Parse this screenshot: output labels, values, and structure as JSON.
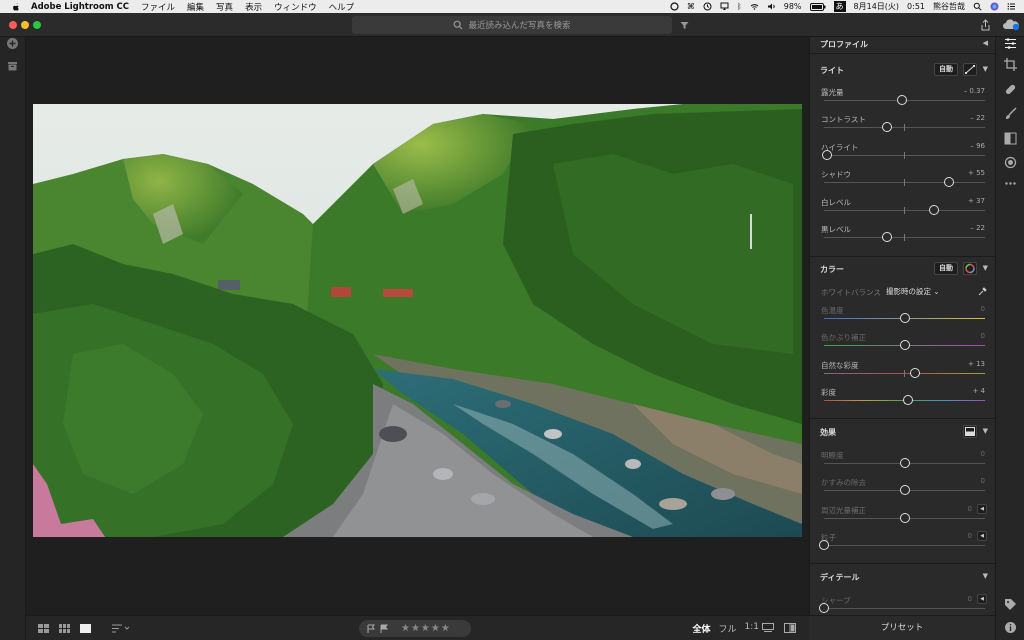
{
  "menubar": {
    "app_name": "Adobe Lightroom CC",
    "menus": [
      "ファイル",
      "編集",
      "写真",
      "表示",
      "ウィンドウ",
      "ヘルプ"
    ],
    "battery": "98%",
    "date": "8月14日(火)",
    "time": "0:51",
    "user": "熊谷哲哉"
  },
  "search": {
    "placeholder": "最近読み込んだ写真を検索"
  },
  "panel": {
    "profile": {
      "title": "プロファイル"
    },
    "light": {
      "title": "ライト",
      "auto_label": "自動",
      "sliders": [
        {
          "label": "露光量",
          "value": "– 0.37",
          "level": -0.037
        },
        {
          "label": "コントラスト",
          "value": "– 22",
          "level": -0.22
        },
        {
          "label": "ハイライト",
          "value": "– 96",
          "level": -0.96
        },
        {
          "label": "シャドウ",
          "value": "+ 55",
          "level": 0.55
        },
        {
          "label": "白レベル",
          "value": "+ 37",
          "level": 0.37
        },
        {
          "label": "黒レベル",
          "value": "– 22",
          "level": -0.22
        }
      ]
    },
    "color": {
      "title": "カラー",
      "auto_label": "自動",
      "wb_label": "ホワイトバランス",
      "wb_value": "撮影時の設定",
      "sliders": [
        {
          "label": "色温度",
          "value": "0",
          "level": 0
        },
        {
          "label": "色かぶり補正",
          "value": "0",
          "level": 0
        },
        {
          "label": "自然な彩度",
          "value": "+ 13",
          "level": 0.13
        },
        {
          "label": "彩度",
          "value": "+ 4",
          "level": 0.04
        }
      ]
    },
    "effects": {
      "title": "効果",
      "sliders": [
        {
          "label": "明瞭度",
          "value": "0",
          "level": 0
        },
        {
          "label": "かすみの除去",
          "value": "0",
          "level": 0
        },
        {
          "label": "周辺光量補正",
          "value": "0",
          "level": 0
        },
        {
          "label": "粒子",
          "value": "0",
          "level": -1
        }
      ]
    },
    "detail": {
      "title": "ディテール",
      "sliders": [
        {
          "label": "シャープ",
          "value": "0",
          "level": -1
        }
      ]
    },
    "preset_label": "プリセット"
  },
  "bottombar": {
    "stars": "★★★★★",
    "zoom_fit": "全体",
    "zoom_fill": "フル",
    "zoom_1to1": "1:1"
  },
  "colors": {
    "accent": "#1473e6",
    "panel_bg": "#2a2a2a",
    "app_bg": "#1e1e1e"
  }
}
